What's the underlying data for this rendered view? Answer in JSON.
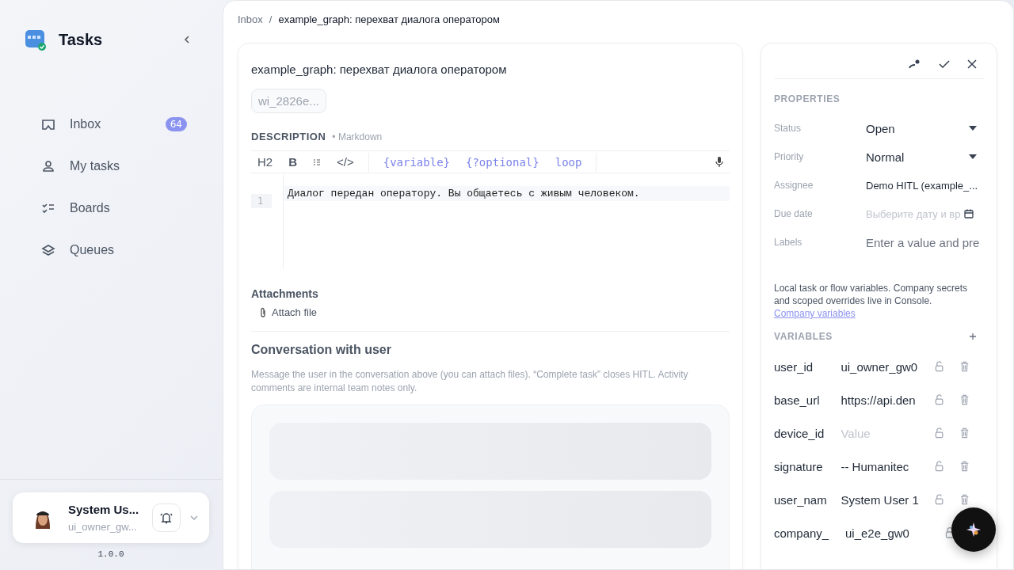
{
  "sidebar": {
    "app_title": "Tasks",
    "nav": [
      {
        "label": "Inbox",
        "badge": "64"
      },
      {
        "label": "My tasks"
      },
      {
        "label": "Boards"
      },
      {
        "label": "Queues"
      }
    ],
    "user": {
      "name": "System Us...",
      "login": "ui_owner_gw..."
    },
    "version": "1.0.0"
  },
  "breadcrumb": [
    "Inbox",
    "example_graph: перехват диалога оператором"
  ],
  "breadcrumb_separator": "/",
  "task": {
    "title": "example_graph: перехват диалога оператором",
    "id_chip": "wi_2826e...",
    "description_label": "DESCRIPTION",
    "description_hint": "• Markdown",
    "toolbar": {
      "format": [
        "H2",
        "B"
      ],
      "code": "</>",
      "snippets": [
        "{variable}",
        "{?optional}",
        "loop"
      ]
    },
    "editor_lines": [
      {
        "number": "1",
        "text": "Диалог передан оператору. Вы общаетесь с живым человеком."
      }
    ],
    "attachments_label": "Attachments",
    "attach_button": "Attach file",
    "conversation_title": "Conversation with user",
    "conversation_note": "Message the user in the conversation above (you can attach files). “Complete task” closes HITL. Activity comments are internal team notes only."
  },
  "properties": {
    "heading": "PROPERTIES",
    "fields": [
      {
        "label": "Status",
        "kind": "select",
        "value": "Open"
      },
      {
        "label": "Priority",
        "kind": "select",
        "value": "Normal"
      },
      {
        "label": "Assignee",
        "kind": "text",
        "value": "Demo HITL (example_..."
      },
      {
        "label": "Due date",
        "kind": "date",
        "placeholder": "Выберите дату и вр"
      },
      {
        "label": "Labels",
        "kind": "input",
        "placeholder": "Enter a value and pre"
      }
    ],
    "help": "Local task or flow variables. Company secrets and scoped overrides live in Console.",
    "help_link": "Company variables",
    "variables_heading": "VARIABLES",
    "variables": [
      {
        "name": "user_id",
        "value": "ui_owner_gw0"
      },
      {
        "name": "base_url",
        "value": "https://api.den"
      },
      {
        "name": "device_id",
        "placeholder": "Value"
      },
      {
        "name": "signature",
        "value": "-- Humanitec"
      },
      {
        "name": "user_nam",
        "value": "System User 1"
      },
      {
        "name": "company_",
        "value": "ui_e2e_gw0"
      }
    ]
  }
}
